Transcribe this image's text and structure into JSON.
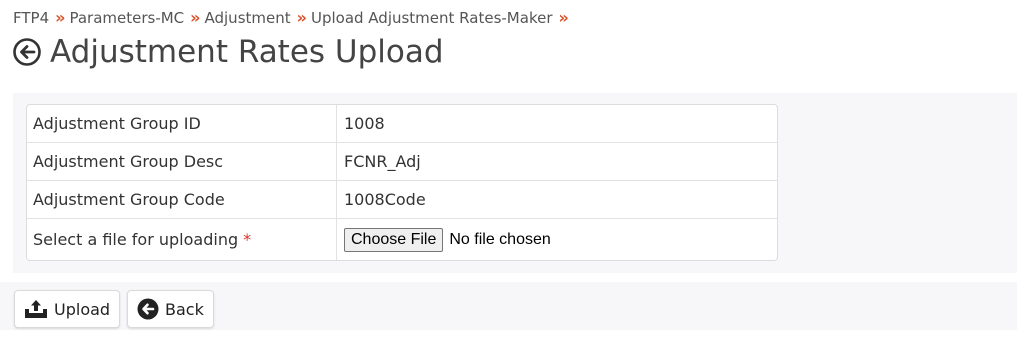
{
  "breadcrumb": {
    "items": [
      "FTP4",
      "Parameters-MC",
      "Adjustment",
      "Upload Adjustment Rates-Maker"
    ],
    "separator": "»"
  },
  "page": {
    "title": "Adjustment Rates Upload"
  },
  "details": {
    "rows": [
      {
        "label": "Adjustment Group ID",
        "value": "1008"
      },
      {
        "label": "Adjustment Group Desc",
        "value": "FCNR_Adj"
      },
      {
        "label": "Adjustment Group Code",
        "value": "1008Code"
      },
      {
        "label": "Select a file for uploading",
        "required_mark": "*"
      }
    ]
  },
  "file_input": {
    "button_label": "Choose File",
    "status": "No file chosen"
  },
  "actions": {
    "upload_label": "Upload",
    "back_label": "Back"
  },
  "colors": {
    "separator": "#d9532c",
    "required": "#d9332c",
    "panel_bg": "#f7f7f9"
  },
  "icons": {
    "title_back": "circle-arrow-left-icon",
    "upload": "upload-tray-icon",
    "back": "circle-arrow-left-filled-icon"
  }
}
